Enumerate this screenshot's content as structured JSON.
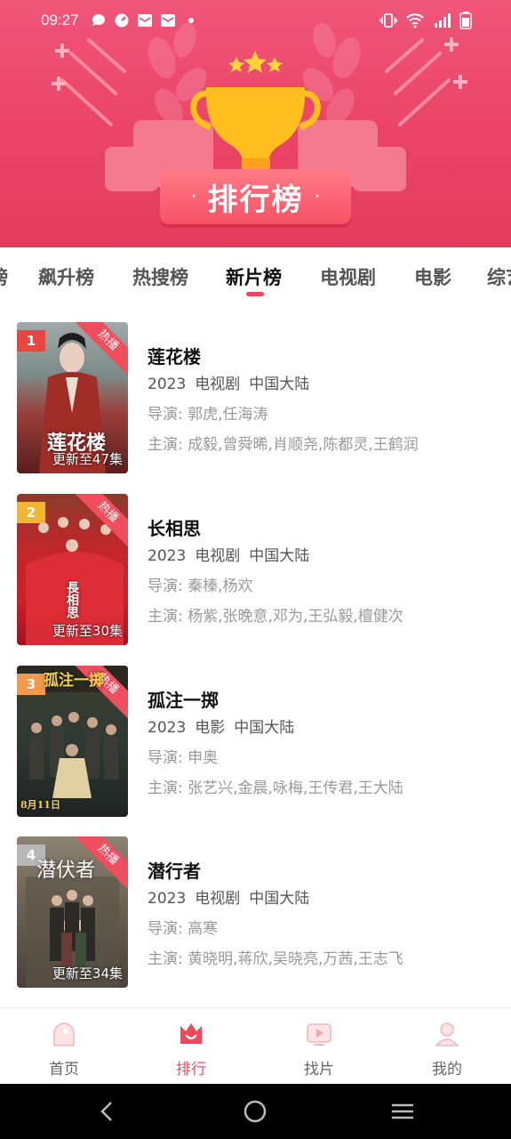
{
  "status_bar": {
    "time": "09:27",
    "left_icons": [
      "message-icon",
      "clock-app-icon",
      "mail-icon",
      "mail-icon",
      "dot-icon"
    ],
    "right_icons": [
      "vibrate-icon",
      "wifi-icon",
      "signal-icon",
      "battery-icon"
    ]
  },
  "banner": {
    "title": "排行榜",
    "dot_left": "·",
    "dot_right": "·"
  },
  "tabs": [
    {
      "label": "榜",
      "active": false
    },
    {
      "label": "飙升榜",
      "active": false
    },
    {
      "label": "热搜榜",
      "active": false
    },
    {
      "label": "新片榜",
      "active": true
    },
    {
      "label": "电视剧",
      "active": false
    },
    {
      "label": "电影",
      "active": false
    },
    {
      "label": "综艺",
      "active": false
    }
  ],
  "items": [
    {
      "rank": "1",
      "rank_color": "#e8463f",
      "badge": "热播",
      "poster_caption": "更新至47集",
      "poster_art_text": "莲花楼",
      "title": "莲花楼",
      "year": "2023",
      "type": "电视剧",
      "region": "中国大陆",
      "director_label": "导演:",
      "director": "郭虎,任海涛",
      "cast_label": "主演:",
      "cast": "成毅,曾舜晞,肖顺尧,陈都灵,王鹤润"
    },
    {
      "rank": "2",
      "rank_color": "#f2b630",
      "badge": "热播",
      "poster_caption": "更新至30集",
      "poster_art_text": "長相思",
      "title": "长相思",
      "year": "2023",
      "type": "电视剧",
      "region": "中国大陆",
      "director_label": "导演:",
      "director": "秦榛,杨欢",
      "cast_label": "主演:",
      "cast": "杨紫,张晚意,邓为,王弘毅,檀健次"
    },
    {
      "rank": "3",
      "rank_color": "#f39a4a",
      "badge": "热播",
      "poster_caption": "",
      "poster_art_text": "孤注一掷",
      "poster_date": "8月11日",
      "title": "孤注一掷",
      "year": "2023",
      "type": "电影",
      "region": "中国大陆",
      "director_label": "导演:",
      "director": "申奥",
      "cast_label": "主演:",
      "cast": "张艺兴,金晨,咏梅,王传君,王大陆"
    },
    {
      "rank": "4",
      "rank_color": "#b8b8b8",
      "badge": "热播",
      "poster_caption": "更新至34集",
      "poster_art_text": "潜伏者",
      "title": "潜行者",
      "year": "2023",
      "type": "电视剧",
      "region": "中国大陆",
      "director_label": "导演:",
      "director": "高寒",
      "cast_label": "主演:",
      "cast": "黄晓明,蒋欣,吴晓亮,万茜,王志飞"
    }
  ],
  "bottom_nav": [
    {
      "label": "首页",
      "icon": "home-icon",
      "active": false
    },
    {
      "label": "排行",
      "icon": "crown-icon",
      "active": true
    },
    {
      "label": "找片",
      "icon": "video-play-icon",
      "active": false
    },
    {
      "label": "我的",
      "icon": "user-icon",
      "active": false
    }
  ],
  "colors": {
    "accent": "#ef4e66",
    "banner_top": "#f0557a",
    "banner_bottom": "#e53b5c",
    "hot_badge": "#f04d5e"
  }
}
